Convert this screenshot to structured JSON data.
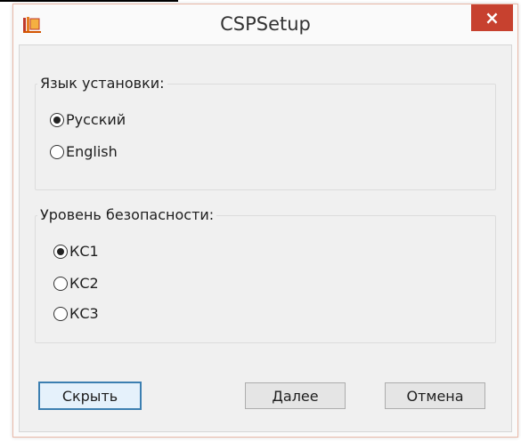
{
  "window": {
    "title": "CSPSetup",
    "close_glyph": "×",
    "icon": "app-icon"
  },
  "language_group": {
    "legend": "Язык установки:",
    "options": [
      {
        "label": "Русский",
        "checked": true
      },
      {
        "label": "English",
        "checked": false
      }
    ]
  },
  "security_group": {
    "legend": "Уровень безопасности:",
    "options": [
      {
        "label": "КС1",
        "checked": true
      },
      {
        "label": "КС2",
        "checked": false
      },
      {
        "label": "КС3",
        "checked": false
      }
    ]
  },
  "buttons": {
    "hide": "Скрыть",
    "next": "Далее",
    "cancel": "Отмена"
  },
  "colors": {
    "close_button": "#c7412f",
    "default_button_border": "#3c7fb1",
    "dialog_background": "#f0f0f0"
  }
}
